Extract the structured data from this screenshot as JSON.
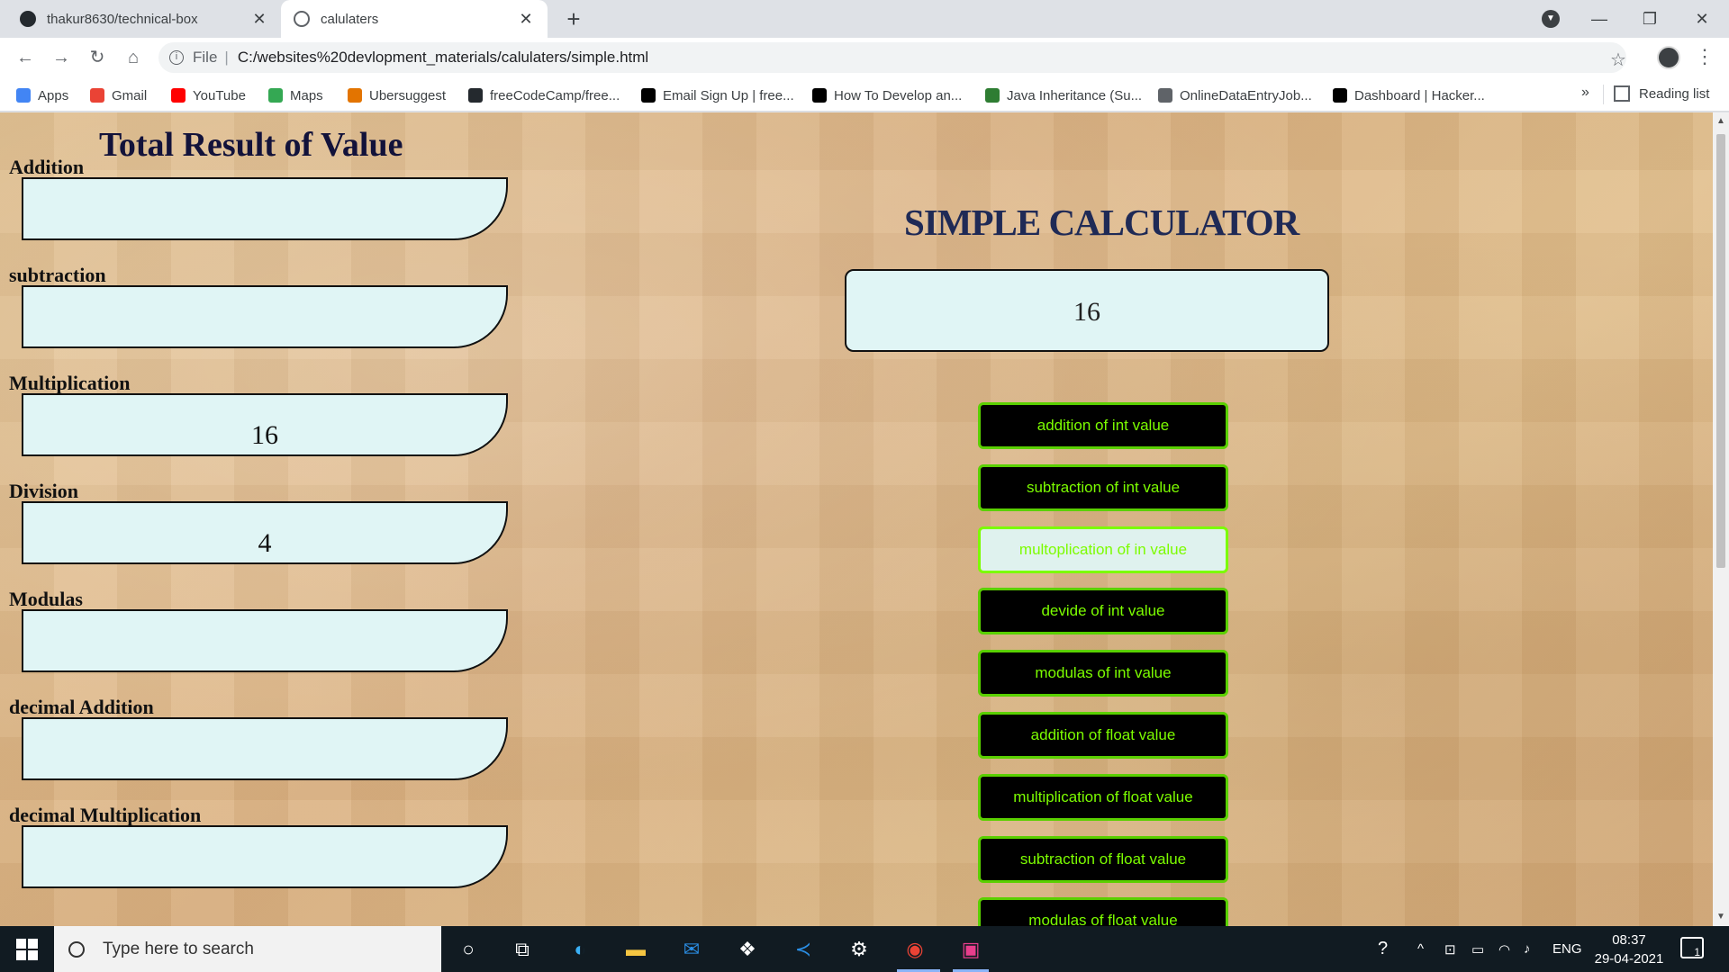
{
  "browser": {
    "tabs": [
      {
        "title": "thakur8630/technical-box"
      },
      {
        "title": "calulaters"
      }
    ],
    "address": {
      "scheme": "File",
      "url": "C:/websites%20devlopment_materials/calulaters/simple.html"
    },
    "bookmarks": [
      {
        "label": "Apps",
        "color": "#4285f4"
      },
      {
        "label": "Gmail",
        "color": "#ea4335"
      },
      {
        "label": "YouTube",
        "color": "#ff0000"
      },
      {
        "label": "Maps",
        "color": "#34a853"
      },
      {
        "label": "Ubersuggest",
        "color": "#e37400"
      },
      {
        "label": "freeCodeCamp/free...",
        "color": "#24292e"
      },
      {
        "label": "Email Sign Up | free...",
        "color": "#000000"
      },
      {
        "label": "How To Develop an...",
        "color": "#000000"
      },
      {
        "label": "Java Inheritance (Su...",
        "color": "#2e7d32"
      },
      {
        "label": "OnlineDataEntryJob...",
        "color": "#5f6368"
      },
      {
        "label": "Dashboard | Hacker...",
        "color": "#000000"
      }
    ],
    "reading_list": "Reading list",
    "more_bookmarks": "»"
  },
  "page": {
    "results_heading": "Total Result of Value",
    "results": [
      {
        "label": "Addition",
        "value": ""
      },
      {
        "label": "subtraction",
        "value": ""
      },
      {
        "label": "Multiplication",
        "value": "16"
      },
      {
        "label": "Division",
        "value": "4"
      },
      {
        "label": "Modulas",
        "value": ""
      },
      {
        "label": "decimal Addition",
        "value": ""
      },
      {
        "label": "decimal Multiplication",
        "value": ""
      }
    ],
    "calc_title": "SIMPLE CALCULATOR",
    "display_value": "16",
    "buttons": [
      {
        "label": "addition of int value"
      },
      {
        "label": "subtraction of int value"
      },
      {
        "label": "multoplication of in value"
      },
      {
        "label": "devide of int value"
      },
      {
        "label": "modulas of int value"
      },
      {
        "label": "addition of float value"
      },
      {
        "label": "multiplication of float value"
      },
      {
        "label": "subtraction of float value"
      },
      {
        "label": "modulas of float value"
      }
    ],
    "active_button_index": 2
  },
  "taskbar": {
    "search_placeholder": "Type here to search",
    "language": "ENG",
    "time": "08:37",
    "date": "29-04-2021",
    "notification_count": "1"
  },
  "colors": {
    "button_bg": "#000000",
    "button_text": "#7CFC00",
    "result_box": "#e0f5f5",
    "title": "#1f2a56"
  }
}
